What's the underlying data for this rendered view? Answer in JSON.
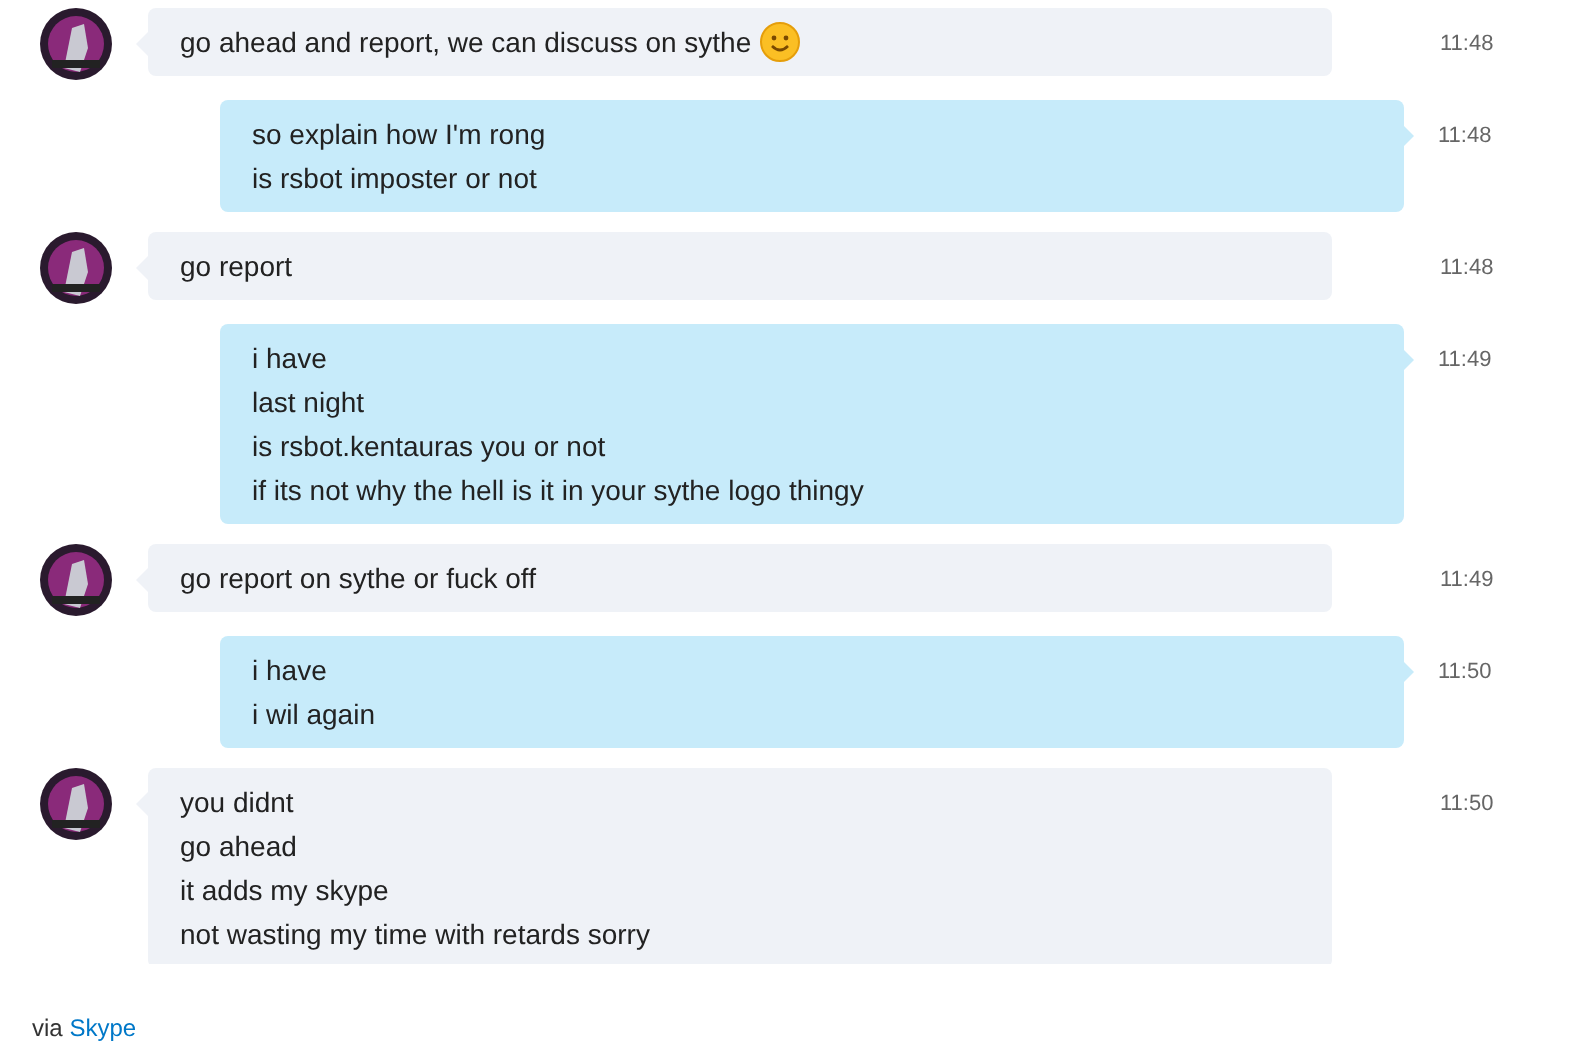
{
  "messages": [
    {
      "kind": "incoming",
      "lines": [
        "go ahead and report, we can discuss on sythe"
      ],
      "emoji": true,
      "time": "11:48"
    },
    {
      "kind": "outgoing",
      "lines": [
        "so explain how I'm rong",
        "is rsbot imposter or not"
      ],
      "emoji": false,
      "time": "11:48"
    },
    {
      "kind": "incoming",
      "lines": [
        "go report"
      ],
      "emoji": false,
      "time": "11:48"
    },
    {
      "kind": "outgoing",
      "lines": [
        "i have",
        "last night",
        "is rsbot.kentauras you or not",
        "if its not why the hell is it in your sythe logo thingy"
      ],
      "emoji": false,
      "time": "11:49"
    },
    {
      "kind": "incoming",
      "lines": [
        "go report on sythe or fuck off"
      ],
      "emoji": false,
      "time": "11:49"
    },
    {
      "kind": "outgoing",
      "lines": [
        "i have",
        "i wil again"
      ],
      "emoji": false,
      "time": "11:50"
    },
    {
      "kind": "incoming",
      "lines": [
        "you didnt",
        "go ahead",
        "it adds my skype",
        "not wasting my time with retards sorry"
      ],
      "emoji": false,
      "time": "11:50"
    }
  ],
  "footer": {
    "prefix": "via",
    "link": "Skype"
  }
}
